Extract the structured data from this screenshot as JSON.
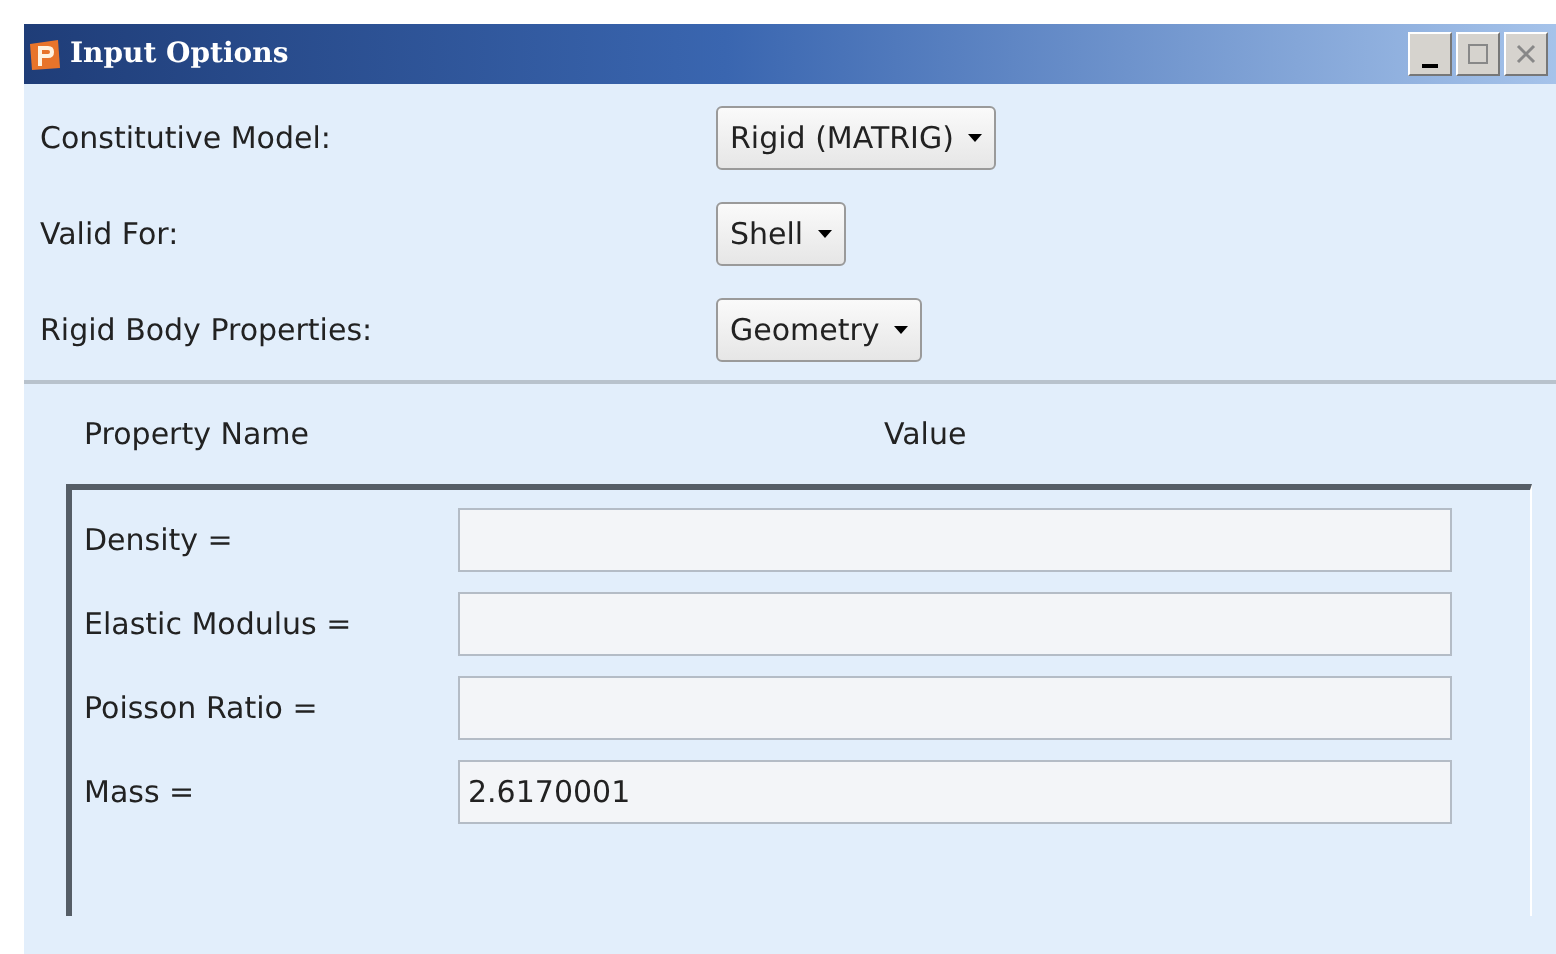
{
  "window": {
    "title": "Input Options"
  },
  "options": [
    {
      "label": "Constitutive Model:",
      "value": "Rigid (MATRIG)"
    },
    {
      "label": "Valid For:",
      "value": "Shell"
    },
    {
      "label": "Rigid Body Properties:",
      "value": "Geometry"
    }
  ],
  "table": {
    "columns": [
      "Property Name",
      "Value"
    ],
    "rows": [
      {
        "name": "Density =",
        "value": ""
      },
      {
        "name": "Elastic Modulus =",
        "value": ""
      },
      {
        "name": "Poisson Ratio =",
        "value": ""
      },
      {
        "name": "Mass =",
        "value": "2.6170001"
      }
    ]
  }
}
